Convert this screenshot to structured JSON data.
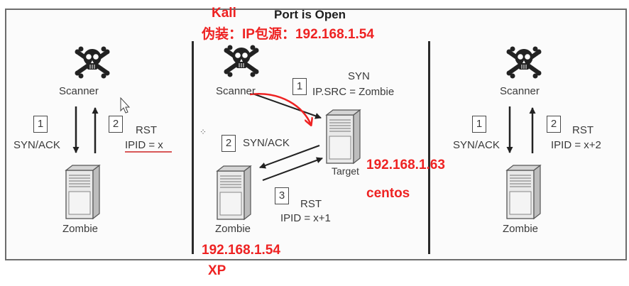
{
  "diagram": {
    "title": "Port is Open",
    "labels": {
      "scanner": "Scanner",
      "zombie": "Zombie",
      "target": "Target"
    },
    "steps": {
      "left_1": "1",
      "left_2": "2",
      "mid_1": "1",
      "mid_2": "2",
      "mid_3": "3",
      "right_1": "1",
      "right_2": "2"
    },
    "packets": {
      "syn_ack": "SYN/ACK",
      "rst": "RST",
      "syn": "SYN",
      "ip_src": "IP.SRC = Zombie"
    },
    "ipid": {
      "left": "IPID = x",
      "mid": "IPID = x+1",
      "right": "IPID = x+2"
    }
  },
  "annotations": {
    "kali": "Kali",
    "spoof": "伪装：IP包源：192.168.1.54",
    "target_ip": "192.168.1.63",
    "target_os": "centos",
    "zombie_ip": "192.168.1.54",
    "zombie_os": "XP",
    "color": "#ee2222"
  },
  "icons": [
    "skull-crossbones-icon",
    "server-icon",
    "mouse-cursor-icon"
  ]
}
